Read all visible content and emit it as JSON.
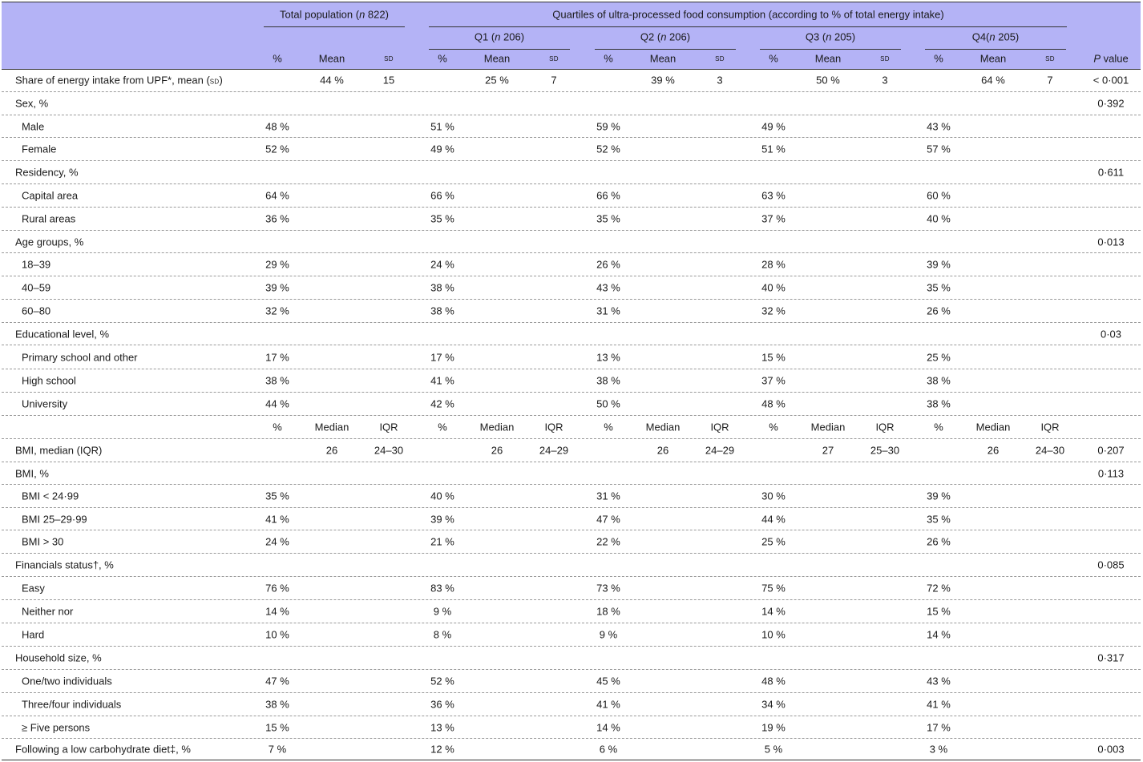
{
  "header": {
    "total": {
      "text": "Total population (",
      "n": "n",
      "value": " 822)"
    },
    "quartiles_title": "Quartiles of ultra-processed food consumption (according to % of total energy intake)",
    "q1": {
      "text": "Q1 (",
      "n": "n",
      "value": " 206)"
    },
    "q2": {
      "text": "Q2 (",
      "n": "n",
      "value": " 206)"
    },
    "q3": {
      "text": "Q3 (",
      "n": "n",
      "value": " 205)"
    },
    "q4": {
      "text": "Q4(",
      "n": "n",
      "value": " 205)"
    },
    "pct": "%",
    "mean": "Mean",
    "sd": "sd",
    "p_value": {
      "p": "P",
      "rest": " value"
    }
  },
  "rows": [
    {
      "label": "Share of energy intake from UPF*, mean (",
      "label_sd": "sd",
      "label_end": ")",
      "type": "meanrow",
      "groups": [
        [
          "",
          "44 %",
          "15"
        ],
        [
          "",
          "25 %",
          "7"
        ],
        [
          "",
          "39 %",
          "3"
        ],
        [
          "",
          "50 %",
          "3"
        ],
        [
          "",
          "64 %",
          "7"
        ]
      ],
      "p": "< 0·001"
    },
    {
      "label": "Sex, %",
      "type": "cat",
      "p": "0·392"
    },
    {
      "label": "Male",
      "type": "sub",
      "vals": [
        "48 %",
        "51 %",
        "59 %",
        "49 %",
        "43 %"
      ]
    },
    {
      "label": "Female",
      "type": "sub",
      "vals": [
        "52 %",
        "49 %",
        "52 %",
        "51 %",
        "57 %"
      ]
    },
    {
      "label": "Residency, %",
      "type": "cat",
      "p": "0·611"
    },
    {
      "label": "Capital area",
      "type": "sub",
      "vals": [
        "64 %",
        "66 %",
        "66 %",
        "63 %",
        "60 %"
      ]
    },
    {
      "label": "Rural areas",
      "type": "sub",
      "vals": [
        "36 %",
        "35 %",
        "35 %",
        "37 %",
        "40 %"
      ]
    },
    {
      "label": "Age groups, %",
      "type": "cat",
      "p": "0·013"
    },
    {
      "label": "18–39",
      "type": "sub",
      "vals": [
        "29 %",
        "24 %",
        "26 %",
        "28 %",
        "39 %"
      ]
    },
    {
      "label": "40–59",
      "type": "sub",
      "vals": [
        "39 %",
        "38 %",
        "43 %",
        "40 %",
        "35 %"
      ]
    },
    {
      "label": "60–80",
      "type": "sub",
      "vals": [
        "32 %",
        "38 %",
        "31 %",
        "32 %",
        "26 %"
      ]
    },
    {
      "label": "Educational level, %",
      "type": "cat",
      "p": "0·03"
    },
    {
      "label": "Primary school and other",
      "type": "sub",
      "vals": [
        "17 %",
        "17 %",
        "13 %",
        "15 %",
        "25 %"
      ]
    },
    {
      "label": "High school",
      "type": "sub",
      "vals": [
        "38 %",
        "41 %",
        "38 %",
        "37 %",
        "38 %"
      ]
    },
    {
      "label": "University",
      "type": "sub",
      "vals": [
        "44 %",
        "42 %",
        "50 %",
        "48 %",
        "38 %"
      ]
    },
    {
      "label": "",
      "type": "subheader",
      "cols": [
        "%",
        "Median",
        "IQR"
      ]
    },
    {
      "label": "BMI, median (IQR)",
      "type": "medrow",
      "groups": [
        [
          "",
          "26",
          "24–30"
        ],
        [
          "",
          "26",
          "24–29"
        ],
        [
          "",
          "26",
          "24–29"
        ],
        [
          "",
          "27",
          "25–30"
        ],
        [
          "",
          "26",
          "24–30"
        ]
      ],
      "p": "0·207"
    },
    {
      "label": "BMI, %",
      "type": "cat",
      "p": "0·113"
    },
    {
      "label": "BMI < 24·99",
      "type": "sub",
      "vals": [
        "35 %",
        "40 %",
        "31 %",
        "30 %",
        "39 %"
      ]
    },
    {
      "label": "BMI 25–29·99",
      "type": "sub",
      "vals": [
        "41 %",
        "39 %",
        "47 %",
        "44 %",
        "35 %"
      ]
    },
    {
      "label": "BMI > 30",
      "type": "sub",
      "vals": [
        "24 %",
        "21 %",
        "22 %",
        "25 %",
        "26 %"
      ]
    },
    {
      "label": "Financials status†, %",
      "type": "cat",
      "p": "0·085"
    },
    {
      "label": "Easy",
      "type": "sub",
      "vals": [
        "76 %",
        "83 %",
        "73 %",
        "75 %",
        "72 %"
      ]
    },
    {
      "label": "Neither nor",
      "type": "sub",
      "vals": [
        "14 %",
        "9 %",
        "18 %",
        "14 %",
        "15 %"
      ]
    },
    {
      "label": "Hard",
      "type": "sub",
      "vals": [
        "10 %",
        "8 %",
        "9 %",
        "10 %",
        "14 %"
      ]
    },
    {
      "label": "Household size, %",
      "type": "cat",
      "p": "0·317"
    },
    {
      "label": "One/two individuals",
      "type": "sub",
      "vals": [
        "47 %",
        "52 %",
        "45 %",
        "48 %",
        "43 %"
      ]
    },
    {
      "label": "Three/four individuals",
      "type": "sub",
      "vals": [
        "38 %",
        "36 %",
        "41 %",
        "34 %",
        "41 %"
      ]
    },
    {
      "label": "≥ Five persons",
      "type": "sub",
      "vals": [
        "15 %",
        "13 %",
        "14 %",
        "19 %",
        "17 %"
      ]
    },
    {
      "label": "Following a low carbohydrate diet‡, %",
      "type": "catvals",
      "vals": [
        "7 %",
        "12 %",
        "6 %",
        "5 %",
        "3 %"
      ],
      "p": "0·003"
    }
  ]
}
